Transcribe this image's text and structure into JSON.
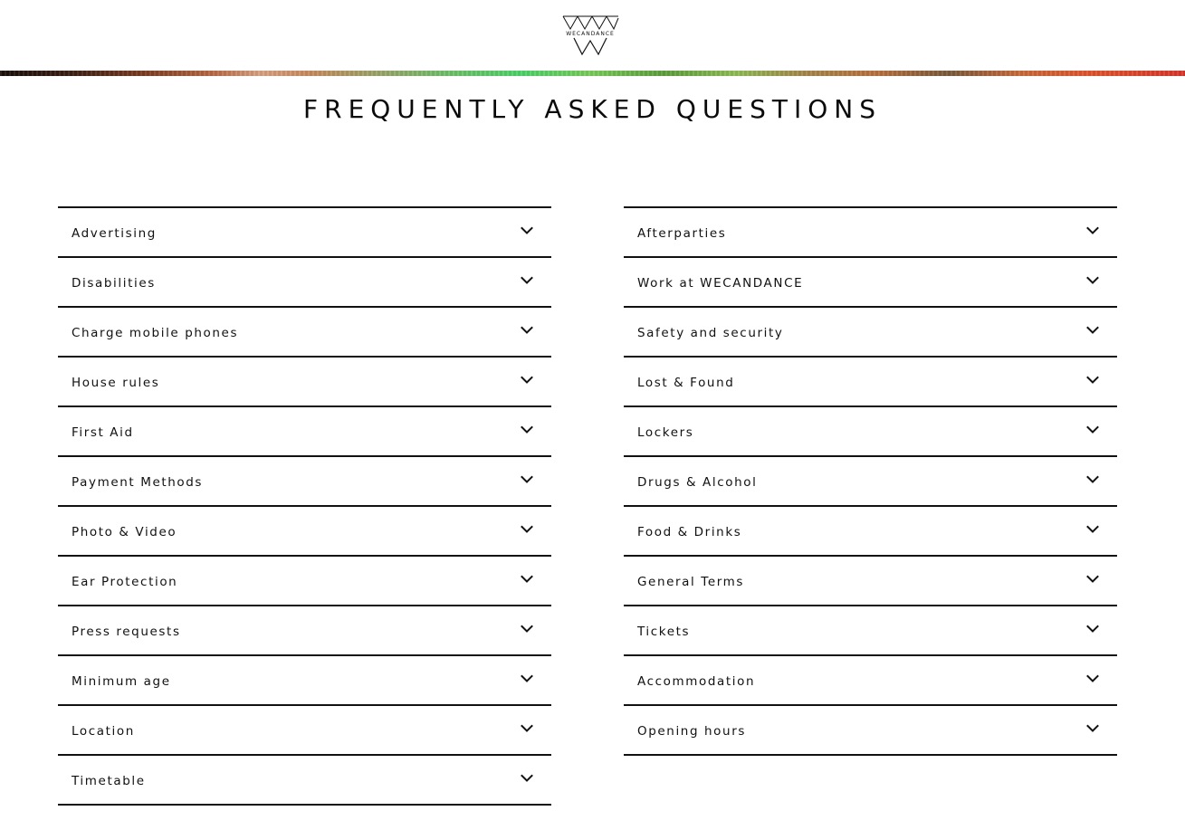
{
  "brand": {
    "logo_text": "WECANDANCE",
    "logo_icon": "wecandance-logo-icon"
  },
  "page": {
    "title": "FREQUENTLY ASKED QUESTIONS"
  },
  "faq": {
    "left": [
      {
        "label": "Advertising"
      },
      {
        "label": "Disabilities"
      },
      {
        "label": "Charge mobile phones"
      },
      {
        "label": "House rules"
      },
      {
        "label": "First Aid"
      },
      {
        "label": "Payment Methods"
      },
      {
        "label": "Photo & Video"
      },
      {
        "label": "Ear Protection"
      },
      {
        "label": "Press requests"
      },
      {
        "label": "Minimum age"
      },
      {
        "label": "Location"
      },
      {
        "label": "Timetable"
      }
    ],
    "right": [
      {
        "label": "Afterparties"
      },
      {
        "label": "Work at WECANDANCE"
      },
      {
        "label": "Safety and security"
      },
      {
        "label": "Lost & Found"
      },
      {
        "label": "Lockers"
      },
      {
        "label": "Drugs & Alcohol"
      },
      {
        "label": "Food & Drinks"
      },
      {
        "label": "General Terms"
      },
      {
        "label": "Tickets"
      },
      {
        "label": "Accommodation"
      },
      {
        "label": "Opening hours"
      }
    ],
    "expand_icon": "chevron-down-icon"
  },
  "colors": {
    "text": "#111111",
    "divider": "#111111",
    "background": "#ffffff"
  }
}
